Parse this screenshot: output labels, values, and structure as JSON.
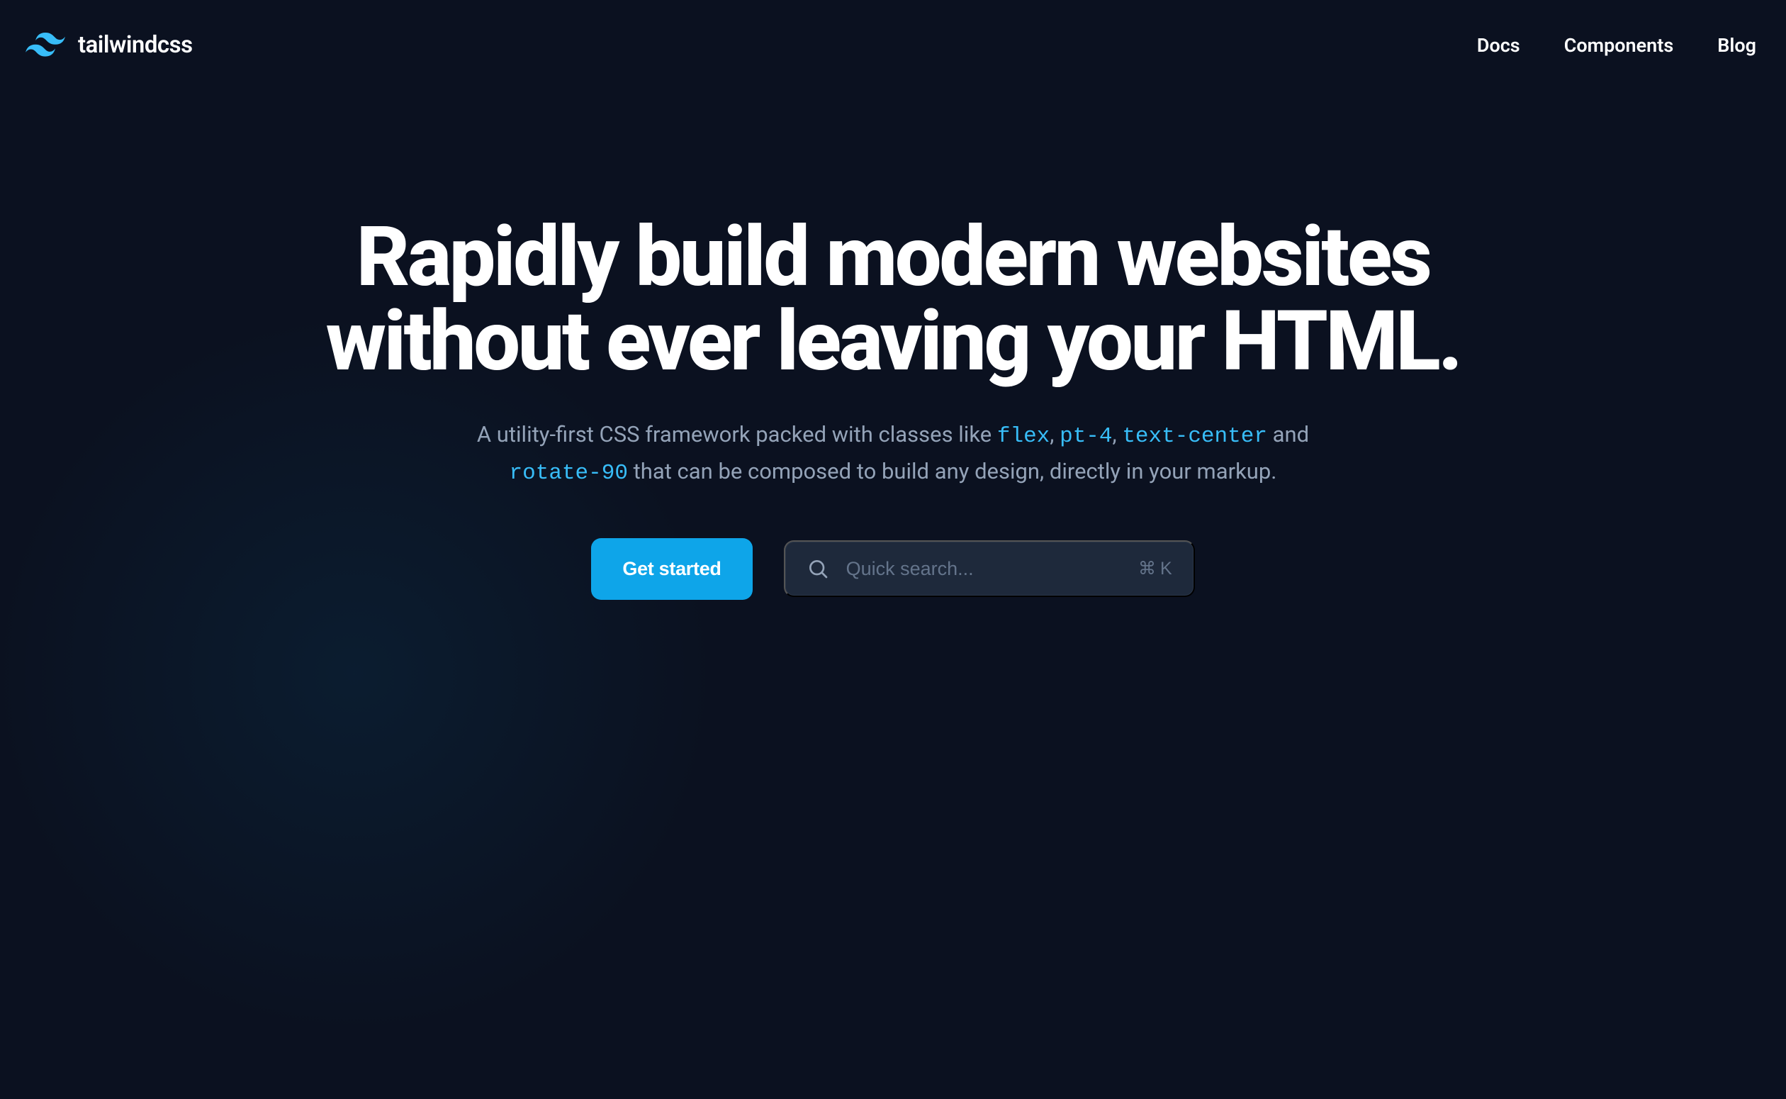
{
  "brand": {
    "name": "tailwindcss"
  },
  "nav": {
    "items": [
      {
        "label": "Docs"
      },
      {
        "label": "Components"
      },
      {
        "label": "Blog"
      }
    ]
  },
  "hero": {
    "title_line1": "Rapidly build modern websites",
    "title_line2": "without ever leaving your HTML.",
    "subtitle_pre": "A utility-first CSS framework packed with classes like ",
    "classes": [
      "flex",
      "pt-4",
      "text-center",
      "rotate-90"
    ],
    "subtitle_sep": ", ",
    "subtitle_and": " and ",
    "subtitle_post": " that can be composed to build any design, directly in your markup.",
    "cta_label": "Get started",
    "search_placeholder": "Quick search...",
    "search_shortcut_cmd": "⌘",
    "search_shortcut_key": "K"
  },
  "colors": {
    "accent": "#0ea5e9",
    "background": "#0b1120",
    "muted": "#94a3b8"
  }
}
